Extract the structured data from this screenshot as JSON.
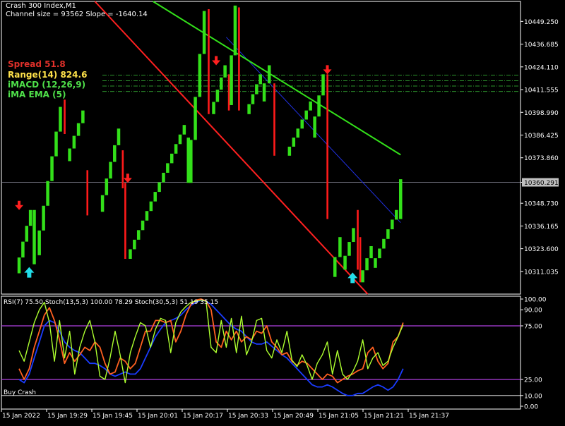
{
  "window": {
    "title": "Crash 300 Index,M1",
    "channel_info": "Channel size = 93562 Slope = -1640.14"
  },
  "indicators": [
    {
      "text": "Spread 51.8",
      "color": "#e0302a"
    },
    {
      "text": "Range(14) 824.6",
      "color": "#ffe24a"
    },
    {
      "text": "iMACD  (12,26,9)",
      "color": "#4fe04a"
    },
    {
      "text": "iMA  EMA (5)",
      "color": "#4fe04a"
    }
  ],
  "subwindow": {
    "header": "RSI(7) 75.50 Stoch(13,5,3) 100.00 78.29 Stoch(30,5,3) 51.19 35.15",
    "footer": "Buy Crash"
  },
  "colors": {
    "background": "#000000",
    "bull": "#33e01a",
    "bear": "#ff1a1a",
    "upper_channel": "#33e01a",
    "lower_channel": "#ff2020",
    "mid_channel": "#2030e0",
    "levels": "#b040e0",
    "rsi": "#adff2f",
    "stoch_fast": "#ff6020",
    "stoch_slow": "#1a3cff",
    "up_arrow": "#22dde8",
    "down_arrow": "#ff2020"
  },
  "chart_data": [
    {
      "type": "candlestick",
      "title": "Crash 300 Index,M1",
      "ylim": [
        10298.5,
        10460.3
      ],
      "price_ticks": [
        "10449.250",
        "10436.685",
        "10424.110",
        "10411.555",
        "10398.990",
        "10386.425",
        "10373.860",
        "10360.291",
        "10348.730",
        "10336.165",
        "10323.600",
        "10311.035"
      ],
      "current_price": 10360.291,
      "channel_upper": [
        [
          "15 Jan 19:56",
          10460.3
        ],
        [
          "15 Jan 21:34",
          10375.5
        ]
      ],
      "channel_lower": [
        [
          "15 Jan 19:33",
          10460.3
        ],
        [
          "15 Jan 21:21",
          10298.5
        ]
      ],
      "channel_mid": [
        [
          "15 Jan 20:25",
          10440.5
        ],
        [
          "15 Jan 21:34",
          10338.0
        ]
      ],
      "grid_levels": [
        10419.5,
        10416.5,
        10413.5,
        10410.5
      ],
      "candles": [
        {
          "t": "15 Jan 19:03",
          "low": 10310.0,
          "high": 10345.0,
          "dir": "up"
        },
        {
          "t": "15 Jan 19:09",
          "low": 10315.0,
          "high": 10345.0,
          "dir": "up"
        },
        {
          "t": "15 Jan 19:11",
          "low": 10320.0,
          "high": 10402.0,
          "dir": "up"
        },
        {
          "t": "15 Jan 19:21",
          "low": 10387.0,
          "high": 10406.0,
          "dir": "down"
        },
        {
          "t": "15 Jan 19:23",
          "low": 10372.0,
          "high": 10400.0,
          "dir": "up"
        },
        {
          "t": "15 Jan 19:30",
          "low": 10342.0,
          "high": 10367.0,
          "dir": "down"
        },
        {
          "t": "15 Jan 19:36",
          "low": 10344.0,
          "high": 10390.0,
          "dir": "up"
        },
        {
          "t": "15 Jan 19:44",
          "low": 10357.0,
          "high": 10378.0,
          "dir": "down"
        },
        {
          "t": "15 Jan 19:45",
          "low": 10318.0,
          "high": 10360.0,
          "dir": "down"
        },
        {
          "t": "15 Jan 19:47",
          "low": 10318.0,
          "high": 10392.0,
          "dir": "up"
        },
        {
          "t": "15 Jan 20:10",
          "low": 10360.0,
          "high": 10385.0,
          "dir": "up"
        },
        {
          "t": "15 Jan 20:11",
          "low": 10360.0,
          "high": 10455.0,
          "dir": "up"
        },
        {
          "t": "15 Jan 20:18",
          "low": 10398.0,
          "high": 10456.0,
          "dir": "down"
        },
        {
          "t": "15 Jan 20:20",
          "low": 10398.0,
          "high": 10425.0,
          "dir": "up"
        },
        {
          "t": "15 Jan 20:26",
          "low": 10400.0,
          "high": 10420.0,
          "dir": "down"
        },
        {
          "t": "15 Jan 20:27",
          "low": 10403.0,
          "high": 10458.0,
          "dir": "up"
        },
        {
          "t": "15 Jan 20:30",
          "low": 10400.0,
          "high": 10457.0,
          "dir": "down"
        },
        {
          "t": "15 Jan 20:34",
          "low": 10398.0,
          "high": 10420.0,
          "dir": "up"
        },
        {
          "t": "15 Jan 20:40",
          "low": 10405.0,
          "high": 10425.0,
          "dir": "up"
        },
        {
          "t": "15 Jan 20:44",
          "low": 10375.0,
          "high": 10415.0,
          "dir": "down"
        },
        {
          "t": "15 Jan 20:50",
          "low": 10375.0,
          "high": 10405.0,
          "dir": "up"
        },
        {
          "t": "15 Jan 21:00",
          "low": 10385.0,
          "high": 10420.0,
          "dir": "up"
        },
        {
          "t": "15 Jan 21:05",
          "low": 10340.0,
          "high": 10420.0,
          "dir": "down"
        },
        {
          "t": "15 Jan 21:08",
          "low": 10308.0,
          "high": 10330.0,
          "dir": "up"
        },
        {
          "t": "15 Jan 21:12",
          "low": 10312.0,
          "high": 10335.0,
          "dir": "up"
        },
        {
          "t": "15 Jan 21:17",
          "low": 10312.0,
          "high": 10345.0,
          "dir": "down"
        },
        {
          "t": "15 Jan 21:18",
          "low": 10305.0,
          "high": 10330.0,
          "dir": "down"
        },
        {
          "t": "15 Jan 21:19",
          "low": 10305.0,
          "high": 10325.0,
          "dir": "up"
        },
        {
          "t": "15 Jan 21:24",
          "low": 10313.0,
          "high": 10345.0,
          "dir": "up"
        },
        {
          "t": "15 Jan 21:34",
          "low": 10340.0,
          "high": 10362.0,
          "dir": "up"
        }
      ],
      "down_arrows": [
        "15 Jan 19:03",
        "15 Jan 19:46",
        "15 Jan 20:21",
        "15 Jan 21:05"
      ],
      "up_arrows": [
        "15 Jan 19:07",
        "15 Jan 21:15"
      ],
      "x_ticks": [
        "15 Jan 2022",
        "15 Jan 19:29",
        "15 Jan 19:45",
        "15 Jan 20:01",
        "15 Jan 20:17",
        "15 Jan 20:33",
        "15 Jan 20:49",
        "15 Jan 21:05",
        "15 Jan 21:21",
        "15 Jan 21:37"
      ]
    },
    {
      "type": "line",
      "title": "RSI(7) 75.50 Stoch(13,5,3) 100.00 78.29 Stoch(30,5,3) 51.19 35.15",
      "ylim": [
        0,
        100
      ],
      "y_ticks": [
        "100.00",
        "90.00",
        "75.00",
        "25.00",
        "10.00",
        "0.00"
      ],
      "levels": [
        75,
        25
      ],
      "x": [
        "19:03",
        "19:05",
        "19:07",
        "19:09",
        "19:11",
        "19:13",
        "19:15",
        "19:17",
        "19:19",
        "19:21",
        "19:23",
        "19:25",
        "19:27",
        "19:29",
        "19:31",
        "19:33",
        "19:35",
        "19:37",
        "19:39",
        "19:41",
        "19:43",
        "19:45",
        "19:47",
        "19:49",
        "19:51",
        "19:53",
        "19:55",
        "19:57",
        "19:59",
        "20:01",
        "20:03",
        "20:05",
        "20:07",
        "20:09",
        "20:11",
        "20:13",
        "20:15",
        "20:17",
        "20:19",
        "20:21",
        "20:23",
        "20:25",
        "20:27",
        "20:29",
        "20:31",
        "20:33",
        "20:35",
        "20:37",
        "20:39",
        "20:41",
        "20:43",
        "20:45",
        "20:47",
        "20:49",
        "20:51",
        "20:53",
        "20:55",
        "20:57",
        "20:59",
        "21:01",
        "21:03",
        "21:05",
        "21:07",
        "21:09",
        "21:11",
        "21:13",
        "21:15",
        "21:17",
        "21:19",
        "21:21",
        "21:23",
        "21:25",
        "21:27",
        "21:29",
        "21:31",
        "21:33",
        "21:35"
      ],
      "series": [
        {
          "name": "RSI(7)",
          "values": [
            52,
            42,
            60,
            78,
            90,
            97,
            78,
            42,
            80,
            45,
            70,
            30,
            55,
            70,
            80,
            60,
            28,
            25,
            45,
            70,
            48,
            22,
            50,
            65,
            78,
            75,
            55,
            72,
            82,
            80,
            50,
            78,
            88,
            93,
            97,
            98,
            99,
            98,
            55,
            50,
            80,
            55,
            82,
            50,
            84,
            48,
            60,
            80,
            82,
            52,
            45,
            62,
            50,
            70,
            43,
            37,
            48,
            38,
            25,
            40,
            48,
            60,
            30,
            52,
            30,
            25,
            32,
            42,
            62,
            35,
            45,
            50,
            38,
            42,
            55,
            65,
            76
          ]
        },
        {
          "name": "Stoch(13,5,3)",
          "values": [
            35,
            25,
            35,
            55,
            70,
            85,
            92,
            80,
            62,
            40,
            50,
            42,
            48,
            55,
            52,
            60,
            55,
            40,
            30,
            32,
            45,
            42,
            35,
            40,
            55,
            70,
            70,
            80,
            80,
            78,
            80,
            60,
            70,
            85,
            95,
            99,
            100,
            98,
            90,
            60,
            55,
            70,
            62,
            70,
            60,
            65,
            62,
            70,
            68,
            75,
            60,
            55,
            48,
            50,
            42,
            38,
            42,
            40,
            35,
            30,
            25,
            30,
            28,
            22,
            25,
            28,
            30,
            33,
            35,
            50,
            55,
            42,
            35,
            40,
            60,
            65,
            78
          ]
        },
        {
          "name": "Stoch(30,5,3)",
          "values": [
            25,
            22,
            30,
            45,
            60,
            75,
            80,
            78,
            70,
            60,
            55,
            52,
            50,
            45,
            40,
            40,
            38,
            35,
            30,
            28,
            30,
            32,
            30,
            30,
            35,
            45,
            55,
            65,
            72,
            78,
            80,
            82,
            85,
            90,
            94,
            97,
            99,
            98,
            95,
            90,
            85,
            80,
            75,
            72,
            70,
            65,
            60,
            58,
            58,
            60,
            56,
            52,
            48,
            45,
            40,
            35,
            30,
            25,
            20,
            18,
            18,
            20,
            18,
            15,
            12,
            10,
            10,
            12,
            12,
            15,
            18,
            20,
            18,
            15,
            18,
            25,
            35
          ]
        }
      ],
      "x_ticks": [
        "15 Jan 2022",
        "15 Jan 19:29",
        "15 Jan 19:45",
        "15 Jan 20:01",
        "15 Jan 20:17",
        "15 Jan 20:33",
        "15 Jan 20:49",
        "15 Jan 21:05",
        "15 Jan 21:21",
        "15 Jan 21:37"
      ]
    }
  ]
}
